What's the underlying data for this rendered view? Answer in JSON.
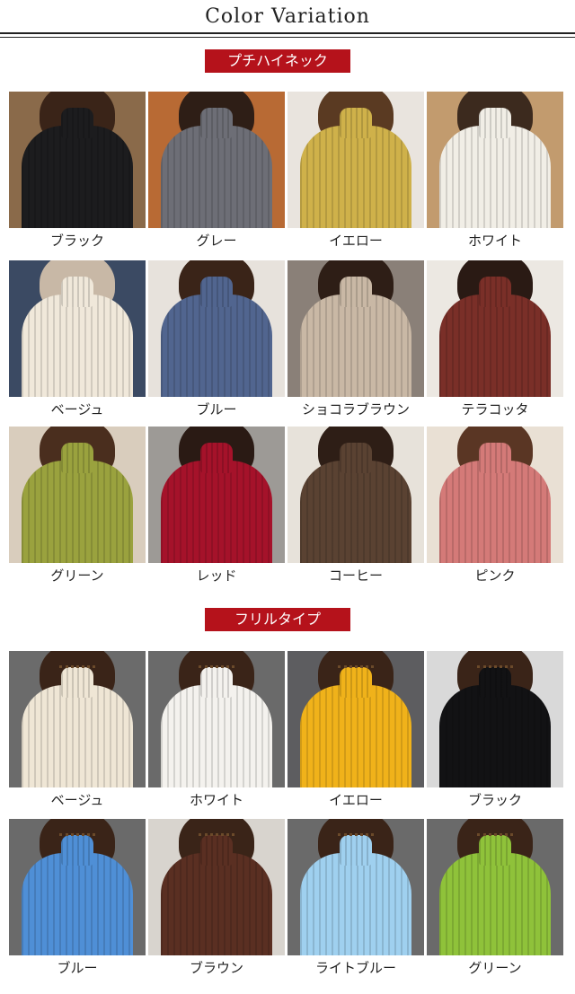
{
  "page_title": "Color Variation",
  "sections": [
    {
      "badge": "プチハイネック",
      "items": [
        {
          "label": "ブラック",
          "sweater": "#1c1c1e",
          "bg": "#8a6a4a",
          "hair": "#3a2418"
        },
        {
          "label": "グレー",
          "sweater": "#6d6e76",
          "bg": "#b86a34",
          "hair": "#2e1e16"
        },
        {
          "label": "イエロー",
          "sweater": "#cfb14a",
          "bg": "#e9e4de",
          "hair": "#5a3a22"
        },
        {
          "label": "ホワイト",
          "sweater": "#f1eee6",
          "bg": "#c29b6e",
          "hair": "#3c2a1e"
        },
        {
          "label": "ベージュ",
          "sweater": "#f0e8da",
          "bg": "#3b4a63",
          "hair": "#c8b8a6"
        },
        {
          "label": "ブルー",
          "sweater": "#51658f",
          "bg": "#e7e2dc",
          "hair": "#3a2418"
        },
        {
          "label": "ショコラブラウン",
          "sweater": "#c9b8a5",
          "bg": "#8a8078",
          "hair": "#2e1e16"
        },
        {
          "label": "テラコッタ",
          "sweater": "#7a2f28",
          "bg": "#ece8e2",
          "hair": "#2a1a14"
        },
        {
          "label": "グリーン",
          "sweater": "#9aa23e",
          "bg": "#d9cdbd",
          "hair": "#4a2e1e"
        },
        {
          "label": "レッド",
          "sweater": "#a5122a",
          "bg": "#9d9a96",
          "hair": "#2a1a14"
        },
        {
          "label": "コーヒー",
          "sweater": "#5a4232",
          "bg": "#e7e2da",
          "hair": "#2e1e16"
        },
        {
          "label": "ピンク",
          "sweater": "#d47a78",
          "bg": "#e9e0d4",
          "hair": "#5a3624"
        }
      ]
    },
    {
      "badge": "フリルタイプ",
      "items": [
        {
          "label": "ベージュ",
          "sweater": "#efe6d5",
          "bg": "#6b6b6b",
          "hair": "#3a2418"
        },
        {
          "label": "ホワイト",
          "sweater": "#f4f2ee",
          "bg": "#6a6a6a",
          "hair": "#3a2418"
        },
        {
          "label": "イエロー",
          "sweater": "#f0b21a",
          "bg": "#5d5d60",
          "hair": "#3a2418"
        },
        {
          "label": "ブラック",
          "sweater": "#121214",
          "bg": "#d9d9d9",
          "hair": "#3a2418"
        },
        {
          "label": "ブルー",
          "sweater": "#4f8fd6",
          "bg": "#6a6a6a",
          "hair": "#3a2418"
        },
        {
          "label": "ブラウン",
          "sweater": "#5a2f22",
          "bg": "#d8d4ce",
          "hair": "#3a2418"
        },
        {
          "label": "ライトブルー",
          "sweater": "#9fd0ef",
          "bg": "#6a6a6a",
          "hair": "#3a2418"
        },
        {
          "label": "グリーン",
          "sweater": "#8fc23a",
          "bg": "#6a6a6a",
          "hair": "#3a2418"
        }
      ]
    }
  ]
}
